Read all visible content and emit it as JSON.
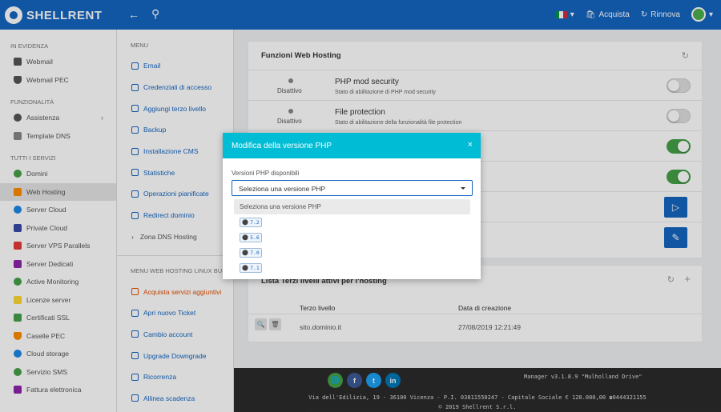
{
  "topbar": {
    "brand": "SHELLRENT",
    "cart_label": "Acquista",
    "renew_label": "Rinnova",
    "flag_colors": [
      "#009246",
      "#ffffff",
      "#ce2b37"
    ],
    "bg_color": "#1565c0"
  },
  "sidebar": {
    "sections": [
      {
        "title": "IN EVIDENZA",
        "items": [
          {
            "label": "Webmail",
            "icon": "mail-icon"
          },
          {
            "label": "Webmail PEC",
            "icon": "shield-icon"
          }
        ]
      },
      {
        "title": "FUNZIONALITÀ",
        "items": [
          {
            "label": "Assistenza",
            "icon": "heart-icon"
          },
          {
            "label": "Template DNS",
            "icon": "chart-icon"
          }
        ]
      },
      {
        "title": "TUTTI I SERVIZI",
        "items": [
          {
            "label": "Domini",
            "icon": "globe-icon"
          },
          {
            "label": "Web Hosting",
            "icon": "rocket-icon"
          },
          {
            "label": "Server Cloud",
            "icon": "cloud-icon"
          },
          {
            "label": "Private Cloud",
            "icon": "grid-icon"
          },
          {
            "label": "Server VPS Parallels",
            "icon": "server-icon"
          },
          {
            "label": "Server Dedicati",
            "icon": "server-icon"
          },
          {
            "label": "Active Monitoring",
            "icon": "monitor-icon"
          },
          {
            "label": "Licenze server",
            "icon": "key-icon"
          },
          {
            "label": "Certificati SSL",
            "icon": "lock-icon"
          },
          {
            "label": "Caselle PEC",
            "icon": "shield-icon"
          },
          {
            "label": "Cloud storage",
            "icon": "cloud-icon"
          },
          {
            "label": "Servizio SMS",
            "icon": "sms-icon"
          },
          {
            "label": "Fattura elettronica",
            "icon": "invoice-icon"
          }
        ]
      }
    ]
  },
  "menu": {
    "title": "MENU",
    "items": [
      "Email",
      "Credenziali di accesso",
      "Aggiungi terzo livello",
      "Backup",
      "Installazione CMS",
      "Statistiche",
      "Operazioni pianificate",
      "Redirect dominio",
      "Zona DNS Hosting"
    ],
    "title2": "MENU WEB HOSTING LINUX BUSIN...",
    "items2": [
      "Acquista servizi aggiuntivi",
      "Apri nuovo Ticket",
      "Cambio account",
      "Upgrade Downgrade",
      "Ricorrenza",
      "Allinea scadenza"
    ]
  },
  "main": {
    "card_title": "Funzioni Web Hosting",
    "rows": [
      {
        "status": "Disattivo",
        "title": "PHP mod security",
        "subtitle": "Stato di abilitazione di PHP mod security"
      },
      {
        "status": "Disattivo",
        "title": "File protection",
        "subtitle": "Stato di abilitazione della funzionalità file protection"
      }
    ],
    "card2_title": "Lista Terzi livelli attivi per l'hosting",
    "table_headers": [
      "Terzo livello",
      "Data di creazione"
    ],
    "table_rows": [
      {
        "subdomain": "sito.dominio.it",
        "created": "27/08/2019 12:21:49"
      }
    ]
  },
  "footer": {
    "version": "Manager v3.1.8.9 \"Mulholland Drive\"",
    "address": "Via dell'Edilizia, 19 - 36100 Vicenza - P.I. 03811550247 - Capitale Sociale € 120.000,00 ☎0444321155",
    "copyright": "© 2019 Shellrent S.r.l.",
    "social": [
      "🌐",
      "f",
      "t",
      "in"
    ]
  },
  "modal": {
    "title": "Modifica della versione PHP",
    "close_glyph": "×",
    "label": "Versioni PHP disponibili",
    "select_value": "Seleziona una versione PHP",
    "options": [
      "Seleziona una versione PHP",
      "7.2",
      "5.6",
      "7.0",
      "7.1"
    ],
    "accent_color": "#00bcd4"
  }
}
